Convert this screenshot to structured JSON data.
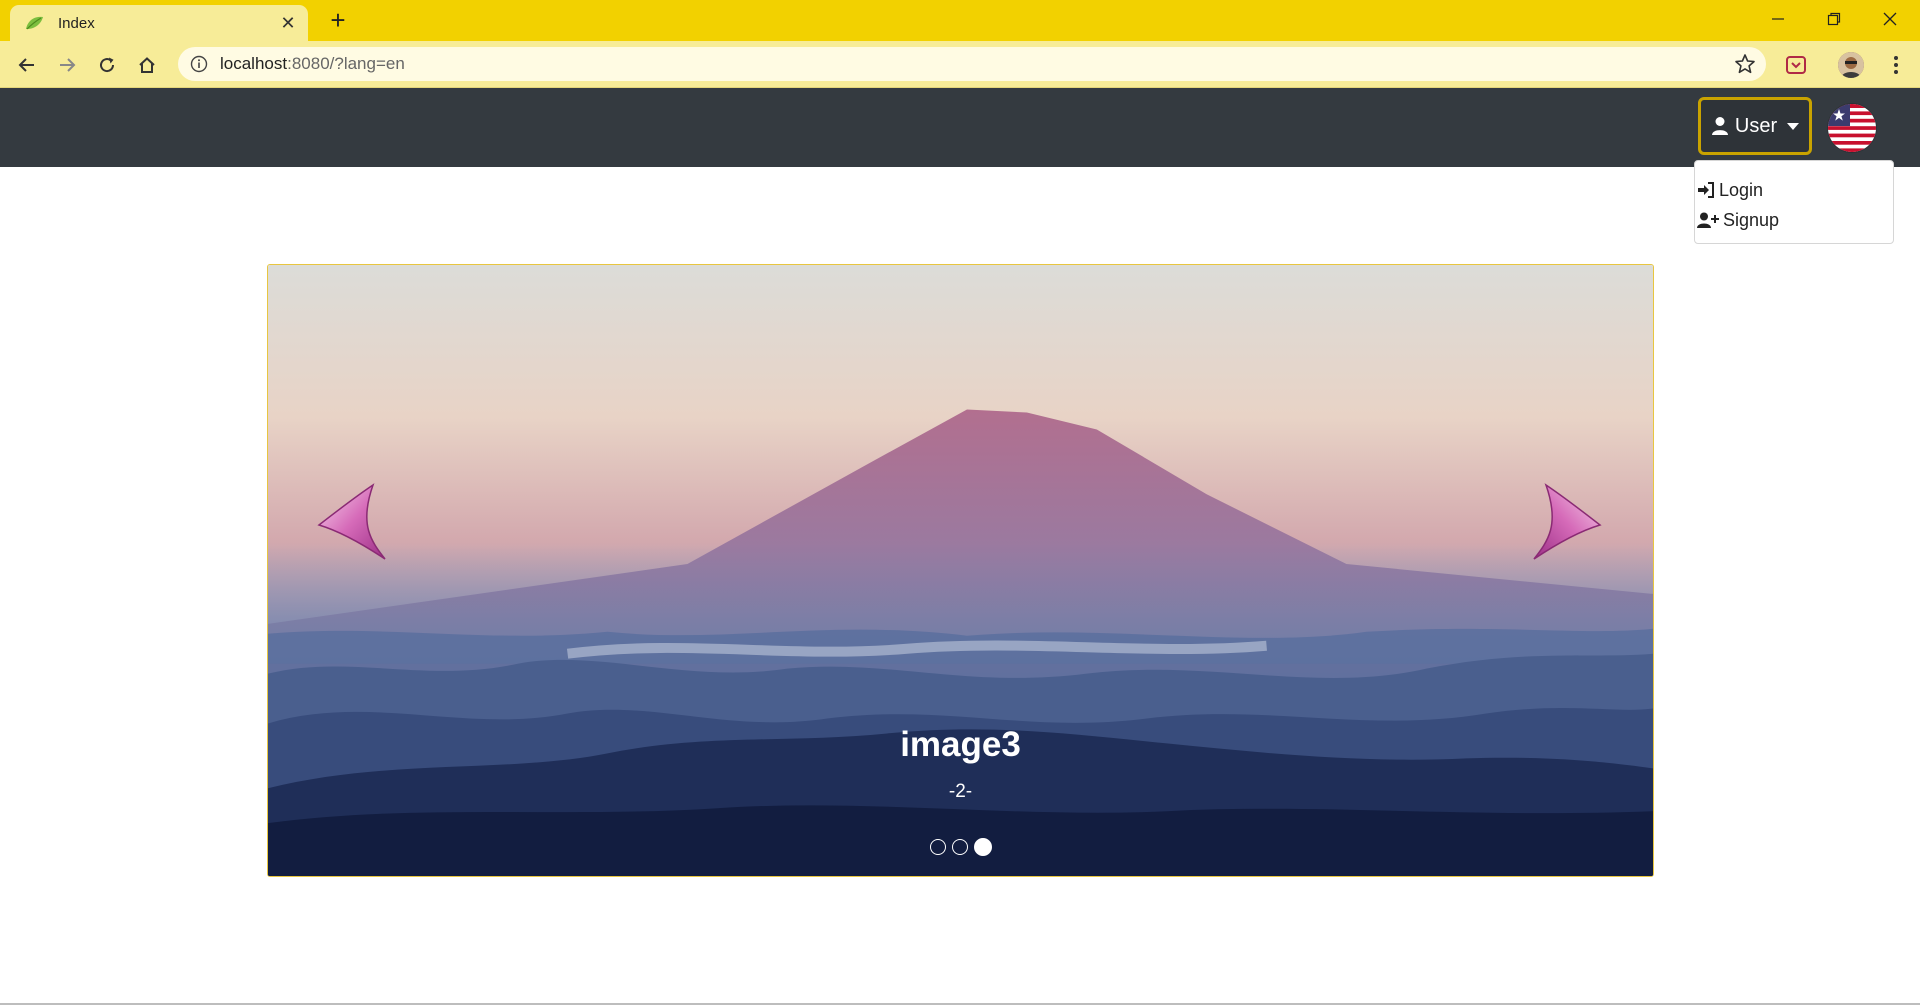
{
  "browser": {
    "tab_title": "Index",
    "url_host": "localhost",
    "url_rest": ":8080/?lang=en",
    "colors": {
      "tabbar": "#f2d100",
      "toolbar": "#f7ec98"
    }
  },
  "navbar": {
    "user_label": "User",
    "flag_icon": "us-flag-icon"
  },
  "dropdown": {
    "items": [
      {
        "label": "Login",
        "icon": "sign-in-icon"
      },
      {
        "label": "Signup",
        "icon": "user-plus-icon"
      }
    ]
  },
  "carousel": {
    "title": "image3",
    "subtitle": "-2-",
    "slide_count": 3,
    "active_index": 2
  }
}
